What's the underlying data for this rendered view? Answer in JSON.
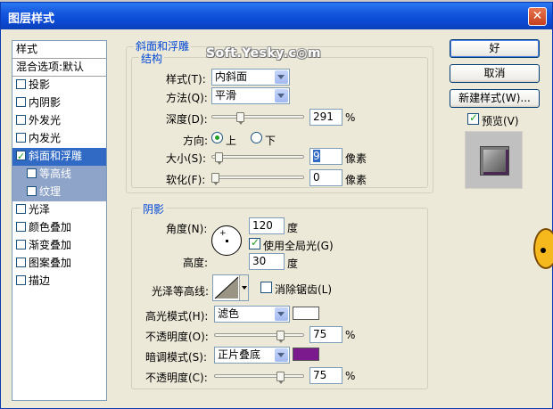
{
  "window": {
    "title": "图层样式",
    "close_symbol": "✕"
  },
  "watermark": "Soft.Yesky.c◎m",
  "style_list": {
    "header": "样式",
    "blend": "混合选项:默认",
    "items": [
      {
        "label": "投影",
        "checked": false
      },
      {
        "label": "内阴影",
        "checked": false
      },
      {
        "label": "外发光",
        "checked": false
      },
      {
        "label": "内发光",
        "checked": false
      },
      {
        "label": "斜面和浮雕",
        "checked": true,
        "selected": true
      },
      {
        "label": "等高线",
        "checked": false,
        "sub": true
      },
      {
        "label": "纹理",
        "checked": false,
        "sub": true
      },
      {
        "label": "光泽",
        "checked": false
      },
      {
        "label": "颜色叠加",
        "checked": false
      },
      {
        "label": "渐变叠加",
        "checked": false
      },
      {
        "label": "图案叠加",
        "checked": false
      },
      {
        "label": "描边",
        "checked": false
      }
    ]
  },
  "bevel": {
    "group_title": "斜面和浮雕",
    "structure_title": "结构",
    "style_label": "样式(T):",
    "style_value": "内斜面",
    "technique_label": "方法(Q):",
    "technique_value": "平滑",
    "depth_label": "深度(D):",
    "depth_value": "291",
    "depth_unit": "%",
    "depth_slider": 0.29,
    "direction_label": "方向:",
    "direction_up": "上",
    "direction_down": "下",
    "direction_selected": "上",
    "size_label": "大小(S):",
    "size_value": "9",
    "size_unit": "像素",
    "size_slider": 0.04,
    "soften_label": "软化(F):",
    "soften_value": "0",
    "soften_unit": "像素",
    "soften_slider": 0.0
  },
  "shading": {
    "group_title": "阴影",
    "angle_label": "角度(N):",
    "angle_value": "120",
    "angle_unit": "度",
    "global_light_label": "使用全局光(G)",
    "global_light_checked": true,
    "altitude_label": "高度:",
    "altitude_value": "30",
    "altitude_unit": "度",
    "gloss_label": "光泽等高线:",
    "antialias_label": "消除锯齿(L)",
    "antialias_checked": false,
    "highlight_mode_label": "高光模式(H):",
    "highlight_mode_value": "滤色",
    "highlight_color": "#ffffff",
    "highlight_opacity_label": "不透明度(O):",
    "highlight_opacity_value": "75",
    "highlight_opacity_unit": "%",
    "highlight_opacity_slider": 0.75,
    "shadow_mode_label": "暗调模式(S):",
    "shadow_mode_value": "正片叠底",
    "shadow_color": "#7a1a8c",
    "shadow_opacity_label": "不透明度(C):",
    "shadow_opacity_value": "75",
    "shadow_opacity_unit": "%",
    "shadow_opacity_slider": 0.75
  },
  "buttons": {
    "ok": "好",
    "cancel": "取消",
    "new_style": "新建样式(W)...",
    "preview_label": "预览(V)",
    "preview_checked": true
  }
}
